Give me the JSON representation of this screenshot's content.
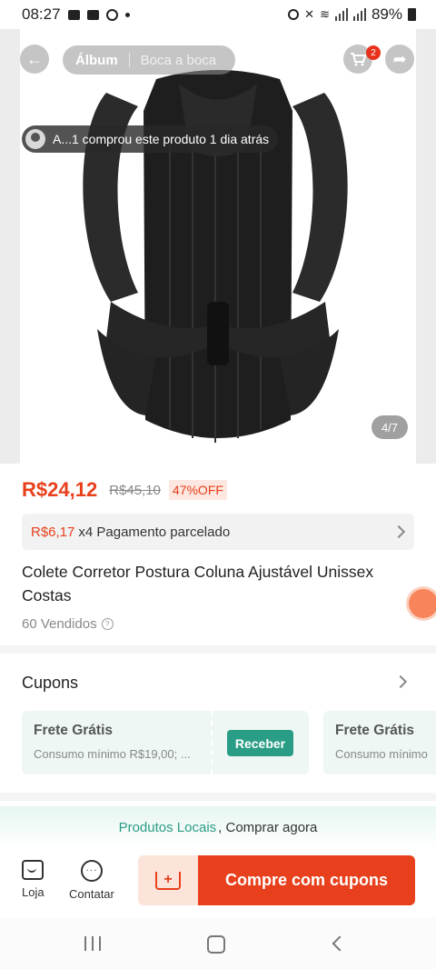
{
  "status_bar": {
    "time": "08:27",
    "battery": "89%"
  },
  "header": {
    "tabs": [
      {
        "label": "Álbum"
      },
      {
        "label": "Boca a boca"
      }
    ],
    "cart_badge": "2"
  },
  "gallery": {
    "purchase_notice": "A...1 comprou este produto 1 dia atrás",
    "counter": "4/7"
  },
  "price": {
    "current": "R$24,12",
    "original": "R$45,10",
    "discount": "47%OFF"
  },
  "installments": {
    "price": "R$6,17",
    "text": "x4 Pagamento parcelado"
  },
  "product": {
    "title": "Colete Corretor Postura Coluna Ajustável Unissex Costas",
    "sold": "60 Vendidos"
  },
  "coupons": {
    "header": "Cupons",
    "items": [
      {
        "title": "Frete Grátis",
        "subtitle": "Consumo mínimo R$19,00; ...",
        "button": "Receber"
      },
      {
        "title": "Frete Grátis",
        "subtitle": "Consumo mínimo"
      }
    ]
  },
  "local_products": {
    "link": "Produtos Locais",
    "text": ", Comprar agora"
  },
  "bottom_bar": {
    "store_label": "Loja",
    "chat_label": "Contatar",
    "buy_label": "Compre com cupons"
  },
  "colors": {
    "accent": "#e8401c",
    "green": "#2a9d86"
  }
}
